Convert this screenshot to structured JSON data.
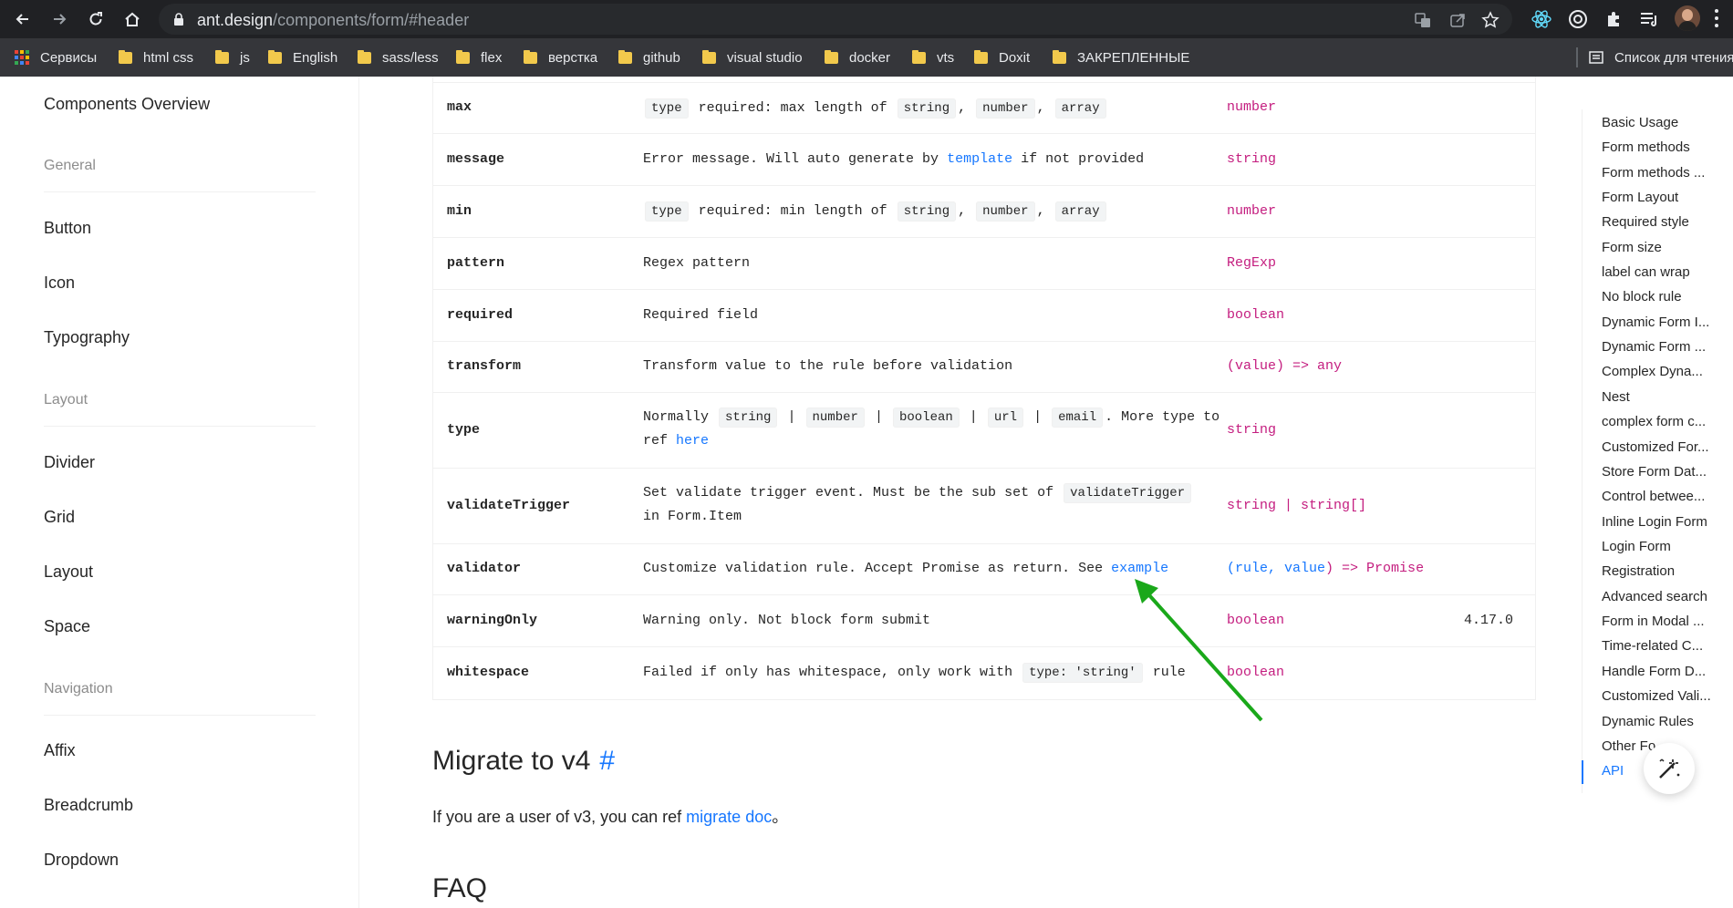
{
  "browser": {
    "url_host": "ant.design",
    "url_path": "/components/form/#header",
    "bookmarks": [
      "Сервисы",
      "html css",
      "js",
      "English",
      "sass/less",
      "flex",
      "верстка",
      "github",
      "visual studio",
      "docker",
      "vts",
      "Doxit",
      "ЗАКРЕПЛЕННЫЕ"
    ],
    "reading_list": "Список для чтения"
  },
  "sidebar": {
    "overview": "Components Overview",
    "groups": [
      {
        "title": "General",
        "items": [
          "Button",
          "Icon",
          "Typography"
        ]
      },
      {
        "title": "Layout",
        "items": [
          "Divider",
          "Grid",
          "Layout",
          "Space"
        ]
      },
      {
        "title": "Navigation",
        "items": [
          "Affix",
          "Breadcrumb",
          "Dropdown"
        ]
      }
    ]
  },
  "table": {
    "rows": [
      {
        "name": "max",
        "type": "number",
        "version": ""
      },
      {
        "name": "message",
        "type": "string",
        "version": ""
      },
      {
        "name": "min",
        "type": "number",
        "version": ""
      },
      {
        "name": "pattern",
        "type": "RegExp",
        "version": ""
      },
      {
        "name": "required",
        "type": "boolean",
        "version": ""
      },
      {
        "name": "transform",
        "type": "(value) => any",
        "version": ""
      },
      {
        "name": "type",
        "type": "string",
        "version": ""
      },
      {
        "name": "validateTrigger",
        "type": "string | string[]",
        "version": ""
      },
      {
        "name": "validator",
        "type": "(rule, value) => Promise",
        "version": ""
      },
      {
        "name": "warningOnly",
        "type": "boolean",
        "version": "4.17.0"
      },
      {
        "name": "whitespace",
        "type": "boolean",
        "version": ""
      }
    ],
    "desc": {
      "max": {
        "code": "type",
        "text": "required: max length of",
        "codes": [
          "string",
          "number",
          "array"
        ],
        "sep": ","
      },
      "message": {
        "pre": "Error message. Will auto generate by",
        "link": "template",
        "post": "if not provided"
      },
      "min": {
        "code": "type",
        "text": "required: min length of",
        "codes": [
          "string",
          "number",
          "array"
        ],
        "sep": ","
      },
      "pattern": "Regex pattern",
      "required": "Required field",
      "transform": "Transform value to the rule before validation",
      "type": {
        "pre": "Normally",
        "codes": [
          "string",
          "number",
          "boolean",
          "url",
          "email"
        ],
        "sep": "|",
        "mid": ". More type to",
        "line2": "ref",
        "link": "here"
      },
      "validateTrigger": {
        "pre": "Set validate trigger event. Must be the sub set of",
        "code": "validateTrigger",
        "line2": "in Form.Item"
      },
      "validator": {
        "pre": "Customize validation rule. Accept Promise as return. See",
        "link": "example"
      },
      "warningOnly": "Warning only. Not block form submit",
      "whitespace": {
        "pre": "Failed if only has whitespace, only work with",
        "code": "type: 'string'",
        "post": "rule"
      }
    }
  },
  "migrate": {
    "title": "Migrate to v4",
    "anchor": "#",
    "text_pre": "If you are a user of v3, you can ref",
    "link": "migrate doc",
    "text_post": "。"
  },
  "faq": {
    "title": "FAQ"
  },
  "toc": {
    "items": [
      "Basic Usage",
      "Form methods",
      "Form methods ...",
      "Form Layout",
      "Required style",
      "Form size",
      "label can wrap",
      "No block rule",
      "Dynamic Form I...",
      "Dynamic Form ...",
      "Complex Dyna...",
      "Nest",
      "complex form c...",
      "Customized For...",
      "Store Form Dat...",
      "Control betwee...",
      "Inline Login Form",
      "Login Form",
      "Registration",
      "Advanced search",
      "Form in Modal ...",
      "Time-related C...",
      "Handle Form D...",
      "Customized Vali...",
      "Dynamic Rules",
      "Other Fo...",
      "API"
    ],
    "active": "API"
  },
  "colors": {
    "link": "#1677ff",
    "type": "#c41d7f",
    "arrow": "#1aa81a"
  }
}
